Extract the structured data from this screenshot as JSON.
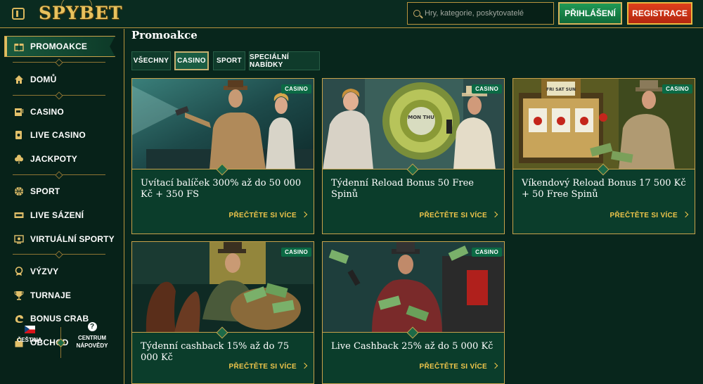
{
  "header": {
    "logo_text": "SPYBET",
    "search_placeholder": "Hry, kategorie, poskytovatelé",
    "login_label": "PŘIHLÁŠENÍ",
    "register_label": "REGISTRACE"
  },
  "sidebar": {
    "items": [
      {
        "label": "PROMOAKCE",
        "icon": "gift-icon"
      },
      {
        "label": "DOMŮ",
        "icon": "home-icon"
      },
      {
        "label": "CASINO",
        "icon": "slot-machine-icon"
      },
      {
        "label": "LIVE CASINO",
        "icon": "live-casino-icon"
      },
      {
        "label": "JACKPOTY",
        "icon": "clover-icon"
      },
      {
        "label": "SPORT",
        "icon": "ball-icon"
      },
      {
        "label": "LIVE SÁZENÍ",
        "icon": "live-badge-icon"
      },
      {
        "label": "VIRTUÁLNÍ SPORTY",
        "icon": "virtual-sports-icon"
      },
      {
        "label": "VÝZVY",
        "icon": "medal-icon"
      },
      {
        "label": "TURNAJE",
        "icon": "trophy-icon"
      },
      {
        "label": "BONUS CRAB",
        "icon": "crab-icon"
      },
      {
        "label": "OBCHOD",
        "icon": "shopping-bag-icon"
      }
    ],
    "language_label": "ČEŠTINA",
    "help_label_line1": "CENTRUM",
    "help_label_line2": "NÁPOVĚDY"
  },
  "main": {
    "title": "Promoakce",
    "tabs": [
      {
        "label": "VŠECHNY",
        "active": false
      },
      {
        "label": "CASINO",
        "active": true
      },
      {
        "label": "SPORT",
        "active": false
      },
      {
        "label": "SPECIÁLNÍ NABÍDKY",
        "active": false
      }
    ],
    "cards": [
      {
        "badge": "CASINO",
        "title": "Uvítací balíček 300% až do 50 000 Kč + 350 FS",
        "link": "PŘEČTĚTE SI VÍCE",
        "scene": "detectives-flashlight"
      },
      {
        "badge": "CASINO",
        "title": "Týdenní Reload Bonus 50 Free Spinů",
        "link": "PŘEČTĚTE SI VÍCE",
        "scene": "vault",
        "vault_text": "MON THU"
      },
      {
        "badge": "CASINO",
        "title": "Víkendový Reload Bonus 17 500 Kč + 50 Free Spinů",
        "link": "PŘEČTĚTE SI VÍCE",
        "scene": "slot-machine",
        "sign_text": "FRI SAT SUN"
      },
      {
        "badge": "CASINO",
        "title": "Týdenní cashback 15% až do 75 000 Kč",
        "link": "PŘEČTĚTE SI VÍCE",
        "scene": "money-bag"
      },
      {
        "badge": "CASINO",
        "title": "Live Cashback 25% až do 5 000 Kč",
        "link": "PŘEČTĚTE SI VÍCE",
        "scene": "money-rain"
      }
    ]
  },
  "colors": {
    "gold": "#c8a24b",
    "bg": "#08261c",
    "login": "#1f9a55",
    "register": "#e0401c",
    "link": "#f0c64b"
  }
}
